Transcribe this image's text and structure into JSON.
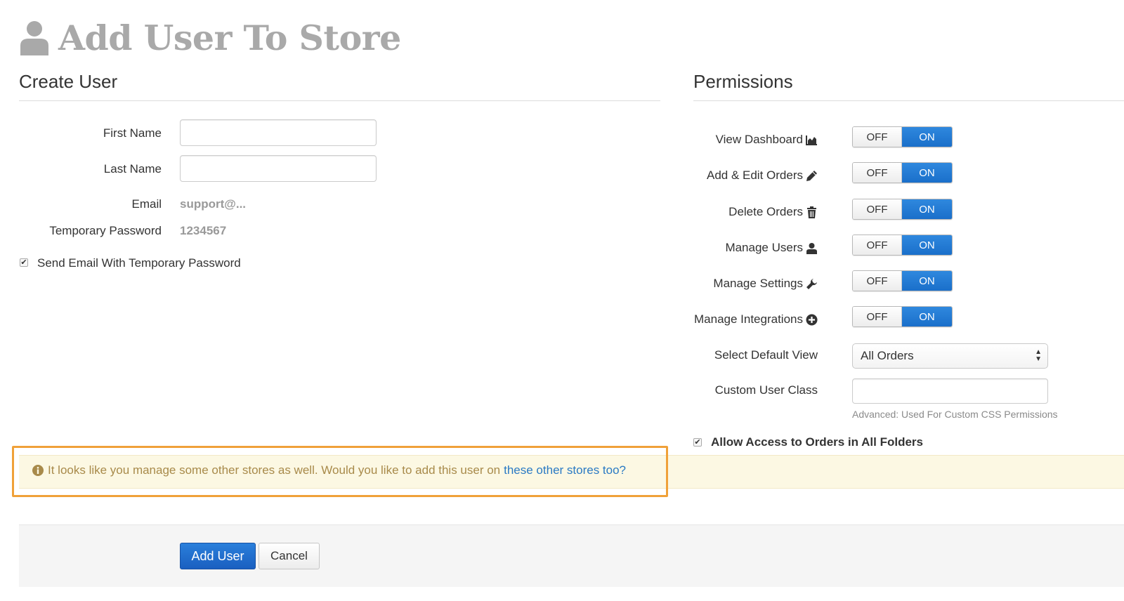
{
  "page": {
    "title": "Add User To Store",
    "header_icon": "user-icon"
  },
  "create_user": {
    "title": "Create User",
    "first_name_label": "First Name",
    "first_name_value": "",
    "last_name_label": "Last Name",
    "last_name_value": "",
    "email_label": "Email",
    "email_value": "support@...",
    "temp_password_label": "Temporary Password",
    "temp_password_value": "1234567",
    "send_email_label": "Send Email With Temporary Password",
    "send_email_checked": true
  },
  "permissions": {
    "title": "Permissions",
    "items": [
      {
        "label": "View Dashboard",
        "icon": "chart-icon",
        "off_label": "OFF",
        "on_label": "ON",
        "state": "on"
      },
      {
        "label": "Add & Edit Orders",
        "icon": "pencil-icon",
        "off_label": "OFF",
        "on_label": "ON",
        "state": "on"
      },
      {
        "label": "Delete Orders",
        "icon": "trash-icon",
        "off_label": "OFF",
        "on_label": "ON",
        "state": "on"
      },
      {
        "label": "Manage Users",
        "icon": "user-icon",
        "off_label": "OFF",
        "on_label": "ON",
        "state": "on"
      },
      {
        "label": "Manage Settings",
        "icon": "wrench-icon",
        "off_label": "OFF",
        "on_label": "ON",
        "state": "on"
      },
      {
        "label": "Manage Integrations",
        "icon": "plus-circle-icon",
        "off_label": "OFF",
        "on_label": "ON",
        "state": "on"
      }
    ],
    "default_view_label": "Select Default View",
    "default_view_value": "All Orders",
    "custom_class_label": "Custom User Class",
    "custom_class_value": "",
    "custom_class_help": "Advanced: Used For Custom CSS Permissions",
    "allow_folders_label": "Allow Access to Orders in All Folders",
    "allow_folders_checked": true
  },
  "alert": {
    "icon": "info-icon",
    "text": "It looks like you manage some other stores as well. Would you like to add this user on",
    "link_text": "these other stores too?"
  },
  "footer": {
    "add_button": "Add User",
    "cancel_button": "Cancel"
  },
  "colors": {
    "primary": "#1a6fca",
    "title_gray": "#a9a9a9",
    "alert_bg": "#fcf8e3",
    "alert_text": "#a88a4a",
    "link": "#2a7ac4",
    "highlight": "#f0a139"
  }
}
